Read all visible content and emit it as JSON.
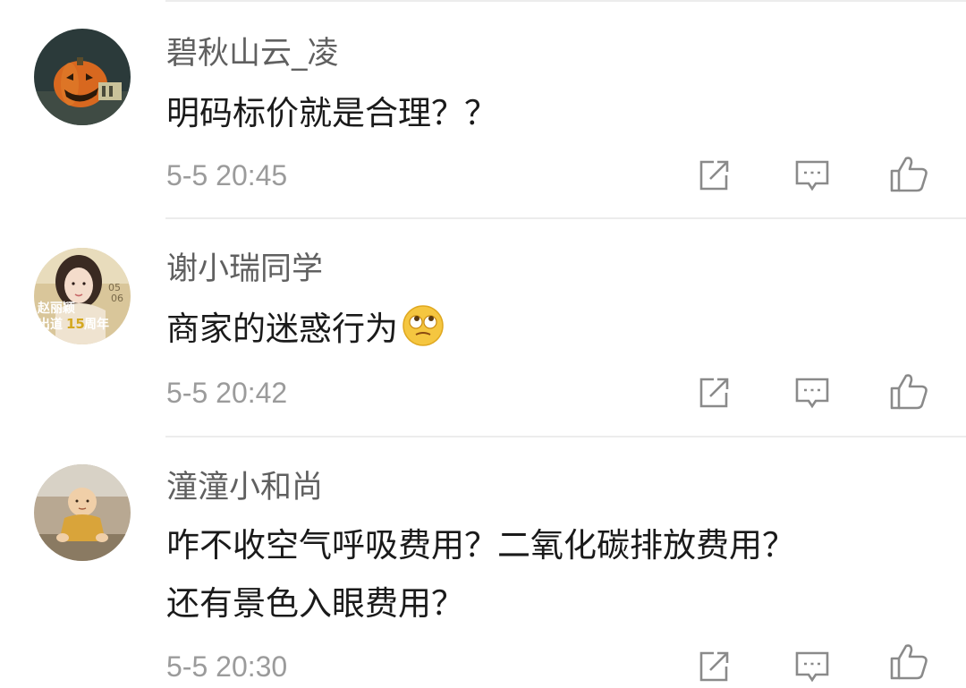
{
  "comments": [
    {
      "username": "碧秋山云_凌",
      "text_lines": [
        "明码标价就是合理？？"
      ],
      "time": "5-5 20:45"
    },
    {
      "username": "谢小瑞同学",
      "text_lines": [
        "商家的迷惑行为"
      ],
      "emoji": "bemused-face-icon",
      "avatar_text": [
        "赵丽颖",
        "出道",
        "15",
        "周年",
        "05",
        "06"
      ],
      "time": "5-5 20:42"
    },
    {
      "username": "潼潼小和尚",
      "text_lines": [
        "咋不收空气呼吸费用？二氧化碳排放费用？",
        "还有景色入眼费用？"
      ],
      "time": "5-5 20:30"
    }
  ],
  "actions": [
    "repost-icon",
    "reply-icon",
    "like-icon"
  ],
  "colors": {
    "username": "#606060",
    "text": "#1a1a1a",
    "time": "#9b9b9b",
    "icon": "#8a8a8a",
    "divider": "#ececec"
  }
}
